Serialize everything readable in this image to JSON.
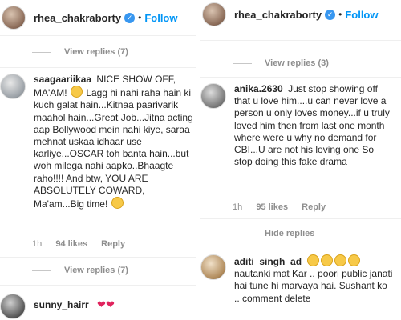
{
  "left": {
    "header": {
      "username": "rhea_chakraborty",
      "dot": "•",
      "follow": "Follow"
    },
    "view_replies_top": "View replies (7)",
    "comment1": {
      "username": "saagaariikaa",
      "text_a": "NICE SHOW OFF, MA'AM!",
      "text_b": "Lagg hi nahi raha hain ki kuch galat hain...Kitnaa paarivarik maahol hain...Great Job...Jitna acting aap Bollywood mein nahi kiye, saraa mehnat uskaa idhaar use karliye...OSCAR toh banta hain...but woh milega nahi aapko..Bhaagte raho!!!! And btw, YOU ARE ABSOLUTELY COWARD, Ma'am...Big time!",
      "time": "1h",
      "likes": "94 likes",
      "reply": "Reply"
    },
    "view_replies_bottom": "View replies (7)",
    "comment2": {
      "username": "sunny_hairr"
    }
  },
  "right": {
    "header": {
      "username": "rhea_chakraborty",
      "dot": "•",
      "follow": "Follow"
    },
    "view_replies_top": "View replies (3)",
    "comment1": {
      "username": "anika.2630",
      "text": "Just stop showing off that u love him....u can never love a person u only loves money...if u truly loved him then from last one month where were u why no demand for CBI...U are not his loving one So stop doing this fake drama",
      "time": "1h",
      "likes": "95 likes",
      "reply": "Reply"
    },
    "hide_replies": "Hide replies",
    "comment2": {
      "username": "aditi_singh_ad",
      "text": "nautanki mat Kar .. poori public janati hai tune hi marvaya hai. Sushant ko .. comment delete"
    }
  },
  "colors": {
    "follow": "#0095f6",
    "verified": "#3897f0",
    "muted": "#8e8e8e",
    "heart": "#e0245e"
  }
}
